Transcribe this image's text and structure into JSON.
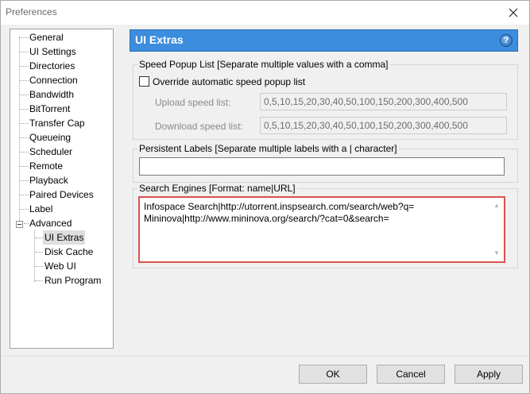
{
  "window": {
    "title": "Preferences"
  },
  "sidebar": {
    "items": [
      {
        "label": "General"
      },
      {
        "label": "UI Settings"
      },
      {
        "label": "Directories"
      },
      {
        "label": "Connection"
      },
      {
        "label": "Bandwidth"
      },
      {
        "label": "BitTorrent"
      },
      {
        "label": "Transfer Cap"
      },
      {
        "label": "Queueing"
      },
      {
        "label": "Scheduler"
      },
      {
        "label": "Remote"
      },
      {
        "label": "Playback"
      },
      {
        "label": "Paired Devices"
      },
      {
        "label": "Label"
      },
      {
        "label": "Advanced"
      },
      {
        "label": "UI Extras"
      },
      {
        "label": "Disk Cache"
      },
      {
        "label": "Web UI"
      },
      {
        "label": "Run Program"
      }
    ],
    "selected": "UI Extras"
  },
  "panel": {
    "title": "UI Extras",
    "help": "?",
    "speed_popup": {
      "group_label": "Speed Popup List [Separate multiple values with a comma]",
      "override_label": "Override automatic speed popup list",
      "override_checked": false,
      "upload_label": "Upload speed list:",
      "upload_value": "0,5,10,15,20,30,40,50,100,150,200,300,400,500",
      "download_label": "Download speed list:",
      "download_value": "0,5,10,15,20,30,40,50,100,150,200,300,400,500"
    },
    "persistent_labels": {
      "group_label": "Persistent Labels [Separate multiple labels with a | character]",
      "value": ""
    },
    "search_engines": {
      "group_label": "Search Engines [Format: name|URL]",
      "lines": [
        "Infospace Search|http://utorrent.inspsearch.com/search/web?q=",
        "Mininova|http://www.mininova.org/search/?cat=0&search="
      ]
    }
  },
  "footer": {
    "ok_label": "OK",
    "cancel_label": "Cancel",
    "apply_label": "Apply"
  },
  "colors": {
    "header_bg": "#3c8dde",
    "highlight_border": "#d9534f"
  }
}
